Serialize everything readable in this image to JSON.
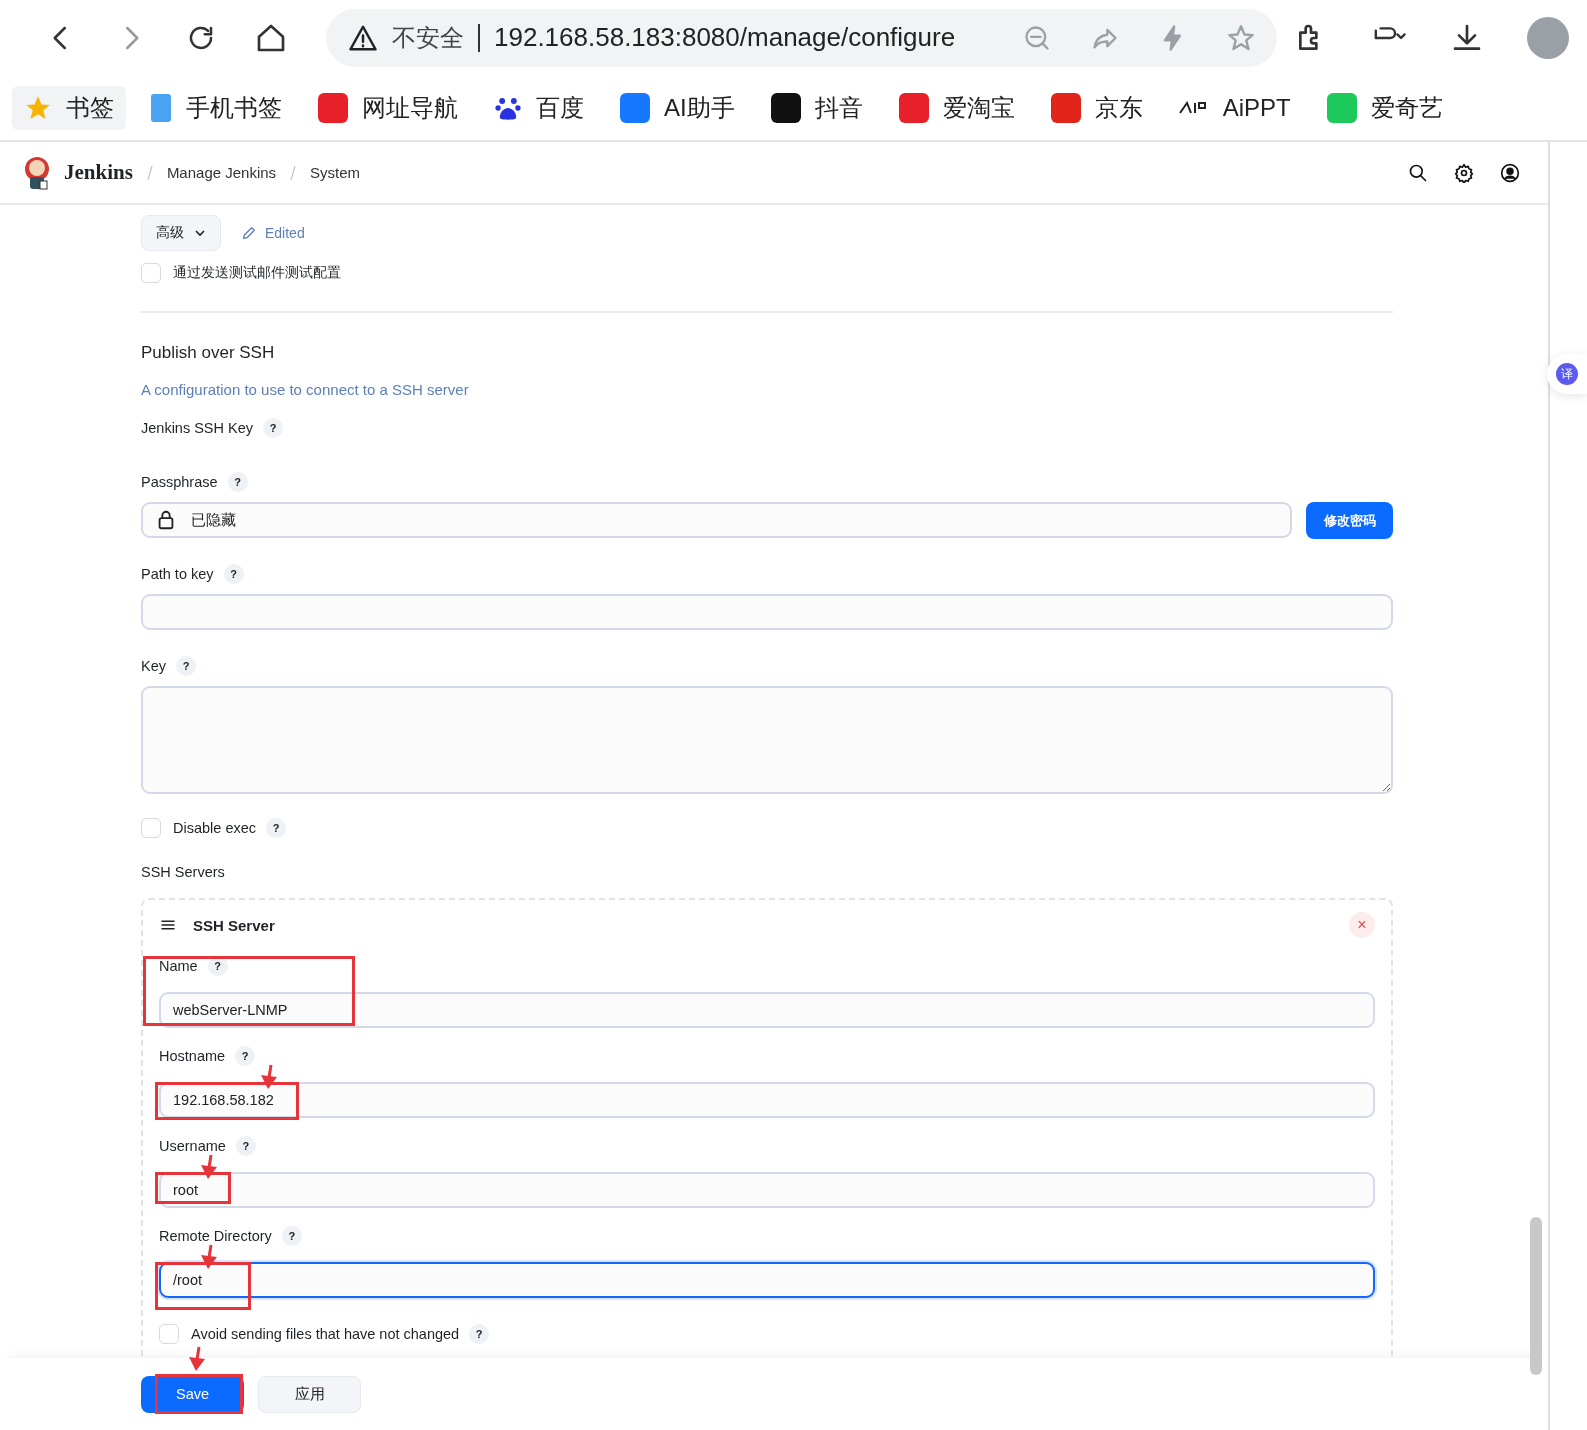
{
  "browser": {
    "security_label": "不安全",
    "url": "192.168.58.183:8080/manage/configure",
    "bookmarks": [
      {
        "label": "书签",
        "color": "#f7b500",
        "kind": "star"
      },
      {
        "label": "手机书签",
        "color": "#4aa3f0",
        "kind": "phone"
      },
      {
        "label": "网址导航",
        "color": "#e8202a",
        "kind": "square"
      },
      {
        "label": "百度",
        "color": "#2932e1",
        "kind": "paw"
      },
      {
        "label": "AI助手",
        "color": "#1677ff",
        "kind": "square"
      },
      {
        "label": "抖音",
        "color": "#111111",
        "kind": "square"
      },
      {
        "label": "爱淘宝",
        "color": "#e8202a",
        "kind": "square"
      },
      {
        "label": "京东",
        "color": "#e1251b",
        "kind": "square"
      },
      {
        "label": "AiPPT",
        "color": "#222222",
        "kind": "mark"
      },
      {
        "label": "爱奇艺",
        "color": "#1ec95b",
        "kind": "square"
      }
    ]
  },
  "header": {
    "brand": "Jenkins",
    "breadcrumbs": [
      "Manage Jenkins",
      "System"
    ]
  },
  "translate_badge": "译",
  "advanced": {
    "label": "高级",
    "edited": "Edited"
  },
  "test_mail": {
    "label": "通过发送测试邮件测试配置",
    "checked": false
  },
  "section": {
    "title": "Publish over SSH",
    "description": "A configuration to use to connect to a SSH server",
    "ssh_key_label": {
      "label": "Jenkins SSH Key",
      "help": "?"
    },
    "passphrase": {
      "label": "Passphrase",
      "help": "?",
      "value": "已隐藏",
      "button": "修改密码"
    },
    "path_to_key": {
      "label": "Path to key",
      "help": "?"
    },
    "key": {
      "label": "Key",
      "help": "?"
    },
    "disable_exec": {
      "label": "Disable exec",
      "help": "?",
      "checked": false
    },
    "servers_label": "SSH Servers",
    "server": {
      "title": "SSH Server",
      "close": "×",
      "fields": [
        {
          "label": "Name",
          "help": "?",
          "value": "webServer-LNMP",
          "focused": false,
          "highlight": true,
          "arrow": false
        },
        {
          "label": "Hostname",
          "help": "?",
          "value": "192.168.58.182",
          "focused": false,
          "highlight": true,
          "arrow": true
        },
        {
          "label": "Username",
          "help": "?",
          "value": "root",
          "focused": false,
          "highlight": true,
          "arrow": true
        },
        {
          "label": "Remote Directory",
          "help": "?",
          "value": "/root",
          "focused": true,
          "highlight": true,
          "arrow": true
        }
      ],
      "avoid": {
        "label": "Avoid sending files that have not changed",
        "help": "?",
        "checked": false
      }
    }
  },
  "actions": [
    {
      "label": "Save",
      "kind": "primary",
      "highlight": true,
      "arrow": true
    },
    {
      "label": "应用",
      "kind": "secondary",
      "highlight": false,
      "arrow": false
    }
  ]
}
